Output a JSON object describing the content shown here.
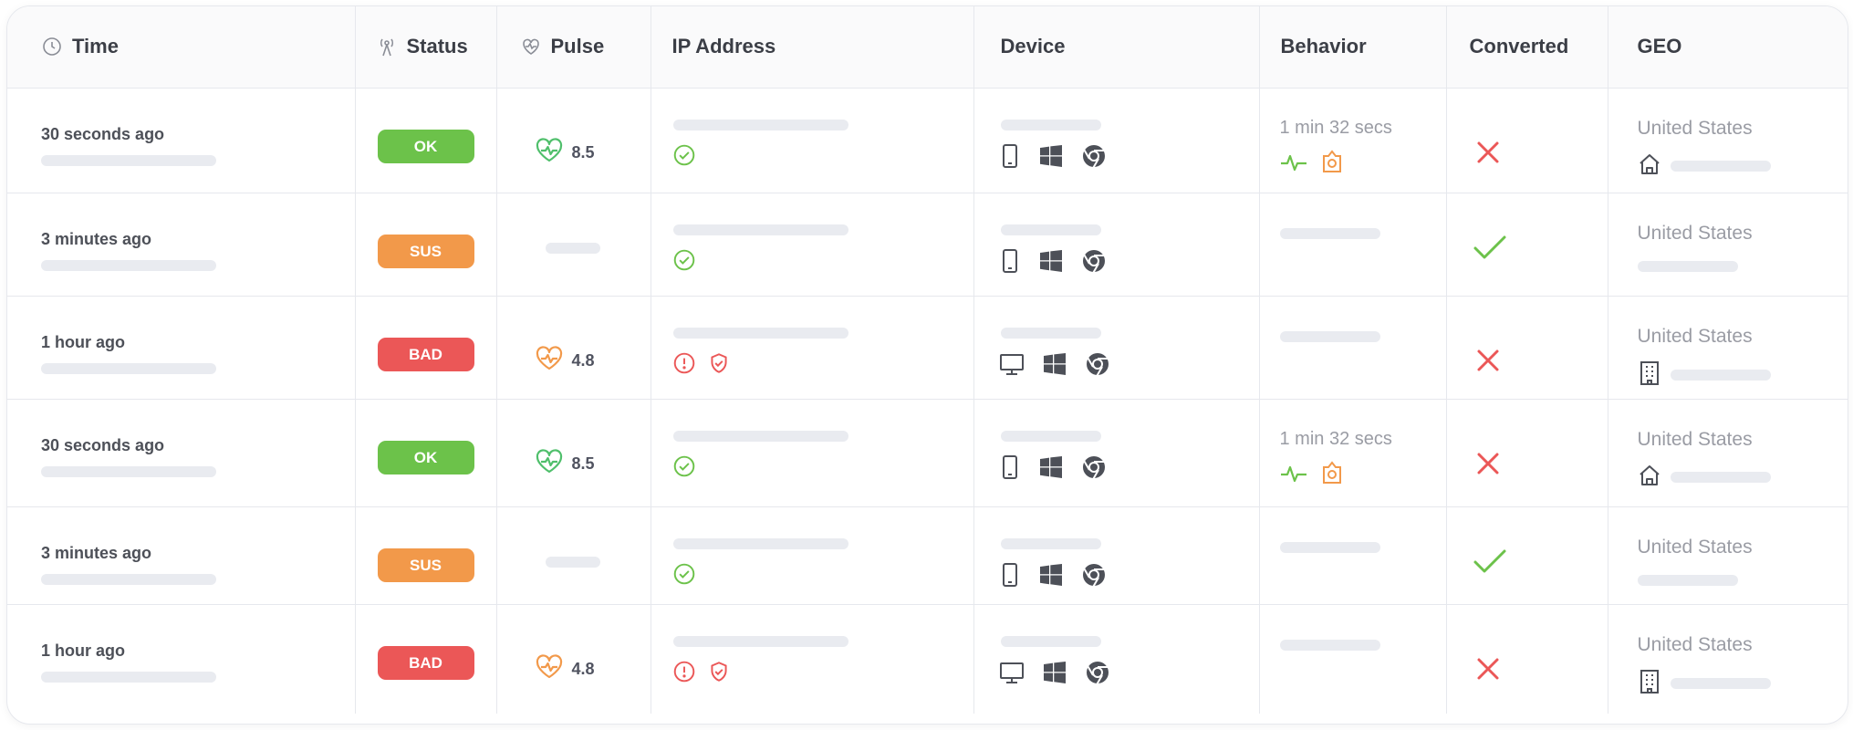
{
  "columns": {
    "time": "Time",
    "status": "Status",
    "pulse": "Pulse",
    "ip": "IP Address",
    "device": "Device",
    "behavior": "Behavior",
    "converted": "Converted",
    "geo": "GEO"
  },
  "colors": {
    "ok": "#6cc24a",
    "sus": "#f2994a",
    "bad": "#eb5757",
    "muted": "#9a9ca4"
  },
  "rows": [
    {
      "time": "30 seconds ago",
      "status": "OK",
      "status_kind": "ok",
      "pulse": "8.5",
      "pulse_icon": "heart-pulse-green-icon",
      "ip_icons": [
        "check-circle-icon"
      ],
      "device_icons": [
        "phone-icon",
        "windows-icon",
        "chrome-icon"
      ],
      "behavior": "1 min 32 secs",
      "behavior_icons": [
        "activity-icon",
        "location-pin-icon"
      ],
      "converted": false,
      "geo": "United States",
      "geo_icon": "home-icon"
    },
    {
      "time": "3 minutes ago",
      "status": "SUS",
      "status_kind": "sus",
      "pulse": "",
      "pulse_icon": "",
      "ip_icons": [
        "check-circle-icon"
      ],
      "device_icons": [
        "phone-icon",
        "windows-icon",
        "chrome-icon"
      ],
      "behavior": "",
      "behavior_icons": [],
      "converted": true,
      "geo": "United States",
      "geo_icon": ""
    },
    {
      "time": "1 hour ago",
      "status": "BAD",
      "status_kind": "bad",
      "pulse": "4.8",
      "pulse_icon": "heart-pulse-orange-icon",
      "ip_icons": [
        "alert-circle-icon",
        "shield-icon"
      ],
      "device_icons": [
        "desktop-icon",
        "windows-icon",
        "chrome-icon"
      ],
      "behavior": "",
      "behavior_icons": [],
      "converted": false,
      "geo": "United States",
      "geo_icon": "building-icon"
    },
    {
      "time": "30 seconds ago",
      "status": "OK",
      "status_kind": "ok",
      "pulse": "8.5",
      "pulse_icon": "heart-pulse-green-icon",
      "ip_icons": [
        "check-circle-icon"
      ],
      "device_icons": [
        "phone-icon",
        "windows-icon",
        "chrome-icon"
      ],
      "behavior": "1 min 32 secs",
      "behavior_icons": [
        "activity-icon",
        "location-pin-icon"
      ],
      "converted": false,
      "geo": "United States",
      "geo_icon": "home-icon"
    },
    {
      "time": "3 minutes ago",
      "status": "SUS",
      "status_kind": "sus",
      "pulse": "",
      "pulse_icon": "",
      "ip_icons": [
        "check-circle-icon"
      ],
      "device_icons": [
        "phone-icon",
        "windows-icon",
        "chrome-icon"
      ],
      "behavior": "",
      "behavior_icons": [],
      "converted": true,
      "geo": "United States",
      "geo_icon": ""
    },
    {
      "time": "1 hour ago",
      "status": "BAD",
      "status_kind": "bad",
      "pulse": "4.8",
      "pulse_icon": "heart-pulse-orange-icon",
      "ip_icons": [
        "alert-circle-icon",
        "shield-icon"
      ],
      "device_icons": [
        "desktop-icon",
        "windows-icon",
        "chrome-icon"
      ],
      "behavior": "",
      "behavior_icons": [],
      "converted": false,
      "geo": "United States",
      "geo_icon": "building-icon"
    }
  ]
}
